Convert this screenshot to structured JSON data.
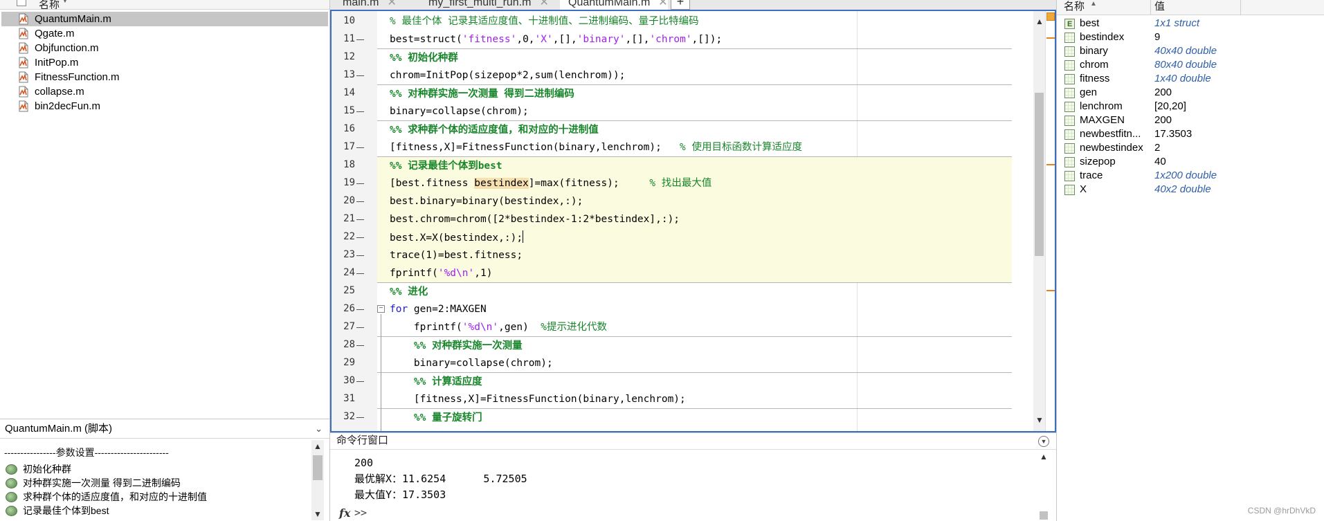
{
  "folder": {
    "column_name": "名称",
    "files": [
      "QuantumMain.m",
      "Qgate.m",
      "Objfunction.m",
      "InitPop.m",
      "FitnessFunction.m",
      "collapse.m",
      "bin2decFun.m"
    ],
    "selected": "QuantumMain.m"
  },
  "details": {
    "title": "QuantumMain.m  (脚本)",
    "separator": "----------------参数设置-----------------------",
    "cells": [
      "初始化种群",
      "对种群实施一次测量 得到二进制编码",
      "求种群个体的适应度值，和对应的十进制值",
      "记录最佳个体到best"
    ]
  },
  "editor": {
    "tabs": [
      "main.m",
      "my_first_multi_run.m",
      "QuantumMain.m"
    ],
    "active_tab": "QuantumMain.m",
    "add_tab_label": "+",
    "line_numbers": [
      "10",
      "11",
      "12",
      "13",
      "14",
      "15",
      "16",
      "17",
      "18",
      "19",
      "20",
      "21",
      "22",
      "23",
      "24",
      "25",
      "26",
      "27",
      "28",
      "29",
      "30",
      "31",
      "32"
    ],
    "lines": {
      "l10": "% 最佳个体 记录其适应度值、十进制值、二进制编码、量子比特编码",
      "l11a": "best=struct(",
      "l11s1": "'fitness'",
      "l11b": ",0,",
      "l11s2": "'X'",
      "l11c": ",[],",
      "l11s3": "'binary'",
      "l11d": ",[],",
      "l11s4": "'chrom'",
      "l11e": ",[]);",
      "l12": "%% 初始化种群",
      "l13": "chrom=InitPop(sizepop*2,sum(lenchrom));",
      "l14": "%% 对种群实施一次测量 得到二进制编码",
      "l15": "binary=collapse(chrom);",
      "l16": "%% 求种群个体的适应度值，和对应的十进制值",
      "l17a": "[fitness,X]=FitnessFunction(binary,lenchrom);   ",
      "l17c": "% 使用目标函数计算适应度",
      "l18": "%% 记录最佳个体到best",
      "l19a": "[best.fitness ",
      "l19v": "bestindex",
      "l19b": "]=max(fitness);     ",
      "l19c": "% 找出最大值",
      "l20": "best.binary=binary(bestindex,:);",
      "l21": "best.chrom=chrom([2*bestindex-1:2*bestindex],:);",
      "l22": "best.X=X(bestindex,:);",
      "l23": "trace(1)=best.fitness;",
      "l24a": "fprintf(",
      "l24s": "'%d\\n'",
      "l24b": ",1)",
      "l25": "%% 进化",
      "l26k": "for",
      "l26b": " gen=2:MAXGEN",
      "l27a": "    fprintf(",
      "l27s": "'%d\\n'",
      "l27b": ",gen)  ",
      "l27c": "%提示进化代数",
      "l28": "    %% 对种群实施一次测量",
      "l29": "    binary=collapse(chrom);",
      "l30": "    %% 计算适应度",
      "l31": "    [fitness,X]=FitnessFunction(binary,lenchrom);",
      "l32": "    %% 量子旋转门"
    }
  },
  "command_window": {
    "title": "命令行窗口",
    "output": [
      "200",
      "最优解X：11.6254      5.72505",
      "最大值Y：17.3503"
    ],
    "fx_label": "fx",
    "prompt": ">>"
  },
  "workspace": {
    "col_name": "名称",
    "col_value": "值",
    "vars": [
      {
        "name": "best",
        "value": "1x1 struct",
        "kind": "struct"
      },
      {
        "name": "bestindex",
        "value": "9",
        "kind": "scalar"
      },
      {
        "name": "binary",
        "value": "40x40 double",
        "kind": "matrix"
      },
      {
        "name": "chrom",
        "value": "80x40 double",
        "kind": "matrix"
      },
      {
        "name": "fitness",
        "value": "1x40 double",
        "kind": "matrix"
      },
      {
        "name": "gen",
        "value": "200",
        "kind": "scalar"
      },
      {
        "name": "lenchrom",
        "value": "[20,20]",
        "kind": "scalar"
      },
      {
        "name": "MAXGEN",
        "value": "200",
        "kind": "scalar"
      },
      {
        "name": "newbestfitn...",
        "value": "17.3503",
        "kind": "scalar"
      },
      {
        "name": "newbestindex",
        "value": "2",
        "kind": "scalar"
      },
      {
        "name": "sizepop",
        "value": "40",
        "kind": "scalar"
      },
      {
        "name": "trace",
        "value": "1x200 double",
        "kind": "matrix"
      },
      {
        "name": "X",
        "value": "40x2 double",
        "kind": "matrix"
      }
    ]
  },
  "watermark": "CSDN @hrDhVkD",
  "colors": {
    "section_comment": "#19862b",
    "string": "#a020f0",
    "keyword": "#1d1ad6",
    "editor_border": "#3f6ec1",
    "highlight_bg": "#fbfbdf",
    "warning_marker": "#e6821e"
  }
}
